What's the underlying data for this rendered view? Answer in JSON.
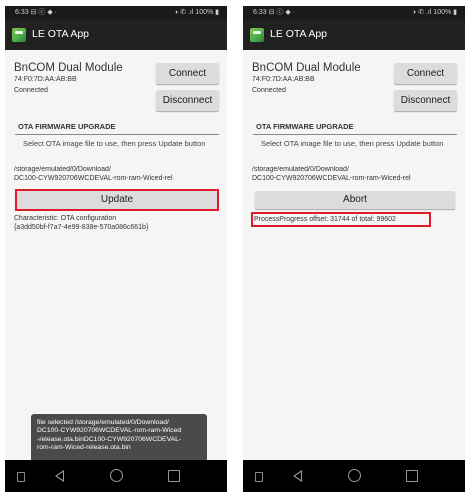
{
  "screen1": {
    "status": {
      "time": "6:33 ⊟ ⓒ ◆ ·",
      "right": "◑ ✆ .ıl 100% ▮"
    },
    "app": {
      "title": "LE OTA App"
    },
    "device": {
      "name": "BnCOM Dual Module",
      "address": "74:F0:7D:AA:AB:BB",
      "status": "Connected"
    },
    "buttons": {
      "connect": "Connect",
      "disconnect": "Disconnect"
    },
    "ota": {
      "section_title": "OTA FIRMWARE UPGRADE",
      "instruction": "Select OTA image file to use, then press Update button",
      "path": "/storage/emulated/0/Download/\nDC100-CYW920706WCDEVAL-rom-ram-Wiced-rel",
      "action_label": "Update",
      "characteristic": "Characteristic: OTA configuration\n{a3dd50bf-f7a7-4e99-838e-570a086c661b}"
    },
    "toast": "file selected /storage/emulated/0/Download/\nDC100-CYW920706WCDEVAL-rom-ram-Wiced\n-release.ota.binDC100-CYW920706WCDEVAL-\nrom-ram-Wiced-release.ota.bin"
  },
  "screen2": {
    "status": {
      "time": "6:33 ⊟ ⓒ ◆ ·",
      "right": "◑ ✆ .ıl 100% ▮"
    },
    "app": {
      "title": "LE OTA App"
    },
    "device": {
      "name": "BnCOM Dual Module",
      "address": "74:F0:7D:AA:AB:BB",
      "status": "Connected"
    },
    "buttons": {
      "connect": "Connect",
      "disconnect": "Disconnect"
    },
    "ota": {
      "section_title": "OTA FIRMWARE UPGRADE",
      "instruction": "Select OTA image file to use, then press Update button",
      "path": "/storage/emulated/0/Download/\nDC100-CYW920706WCDEVAL-rom-ram-Wiced-rel",
      "action_label": "Abort",
      "progress": "ProcessProgress offset: 31744 of total: 99602"
    }
  },
  "colors": {
    "highlight": "#e01b2b",
    "action_bar": "#212121",
    "button": "#dcdcdc"
  },
  "icons": [
    "app-icon",
    "menu-icon",
    "back-icon",
    "home-icon",
    "recent-apps-icon"
  ]
}
